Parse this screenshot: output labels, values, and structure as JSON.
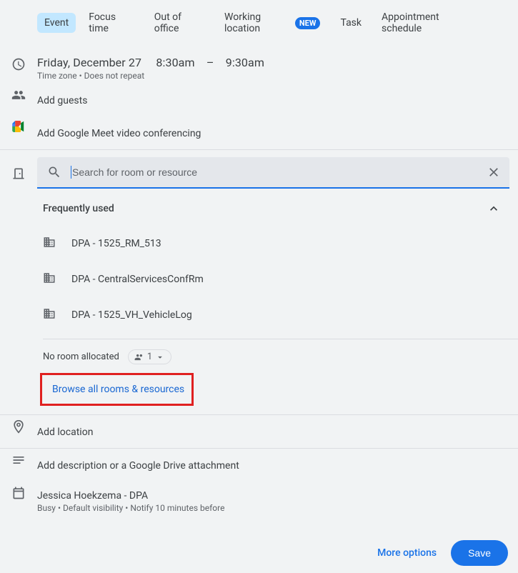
{
  "tabs": {
    "event": "Event",
    "focus": "Focus time",
    "ooo": "Out of office",
    "wl": "Working location",
    "wl_badge": "NEW",
    "task": "Task",
    "appt": "Appointment schedule"
  },
  "datetime": {
    "date": "Friday, December 27",
    "start": "8:30am",
    "sep": "–",
    "end": "9:30am",
    "tz": "Time zone",
    "repeat": "Does not repeat"
  },
  "guests": {
    "add": "Add guests"
  },
  "meet": {
    "add": "Add Google Meet video conferencing"
  },
  "search": {
    "placeholder": "Search for room or resource"
  },
  "freq": {
    "header": "Frequently used",
    "rooms": [
      {
        "label": "DPA - 1525_RM_513"
      },
      {
        "label": "DPA - CentralServicesConfRm"
      },
      {
        "label": "DPA - 1525_VH_VehicleLog"
      }
    ]
  },
  "allocation": {
    "none": "No room allocated",
    "count": "1"
  },
  "browse": {
    "label": "Browse all rooms & resources"
  },
  "location": {
    "add": "Add location"
  },
  "description": {
    "add": "Add description or a Google Drive attachment"
  },
  "calendar": {
    "name": "Jessica Hoekzema - DPA",
    "dot_color": "#d81b60",
    "busy": "Busy",
    "visibility": "Default visibility",
    "notify": "Notify 10 minutes before"
  },
  "footer": {
    "more": "More options",
    "save": "Save"
  }
}
